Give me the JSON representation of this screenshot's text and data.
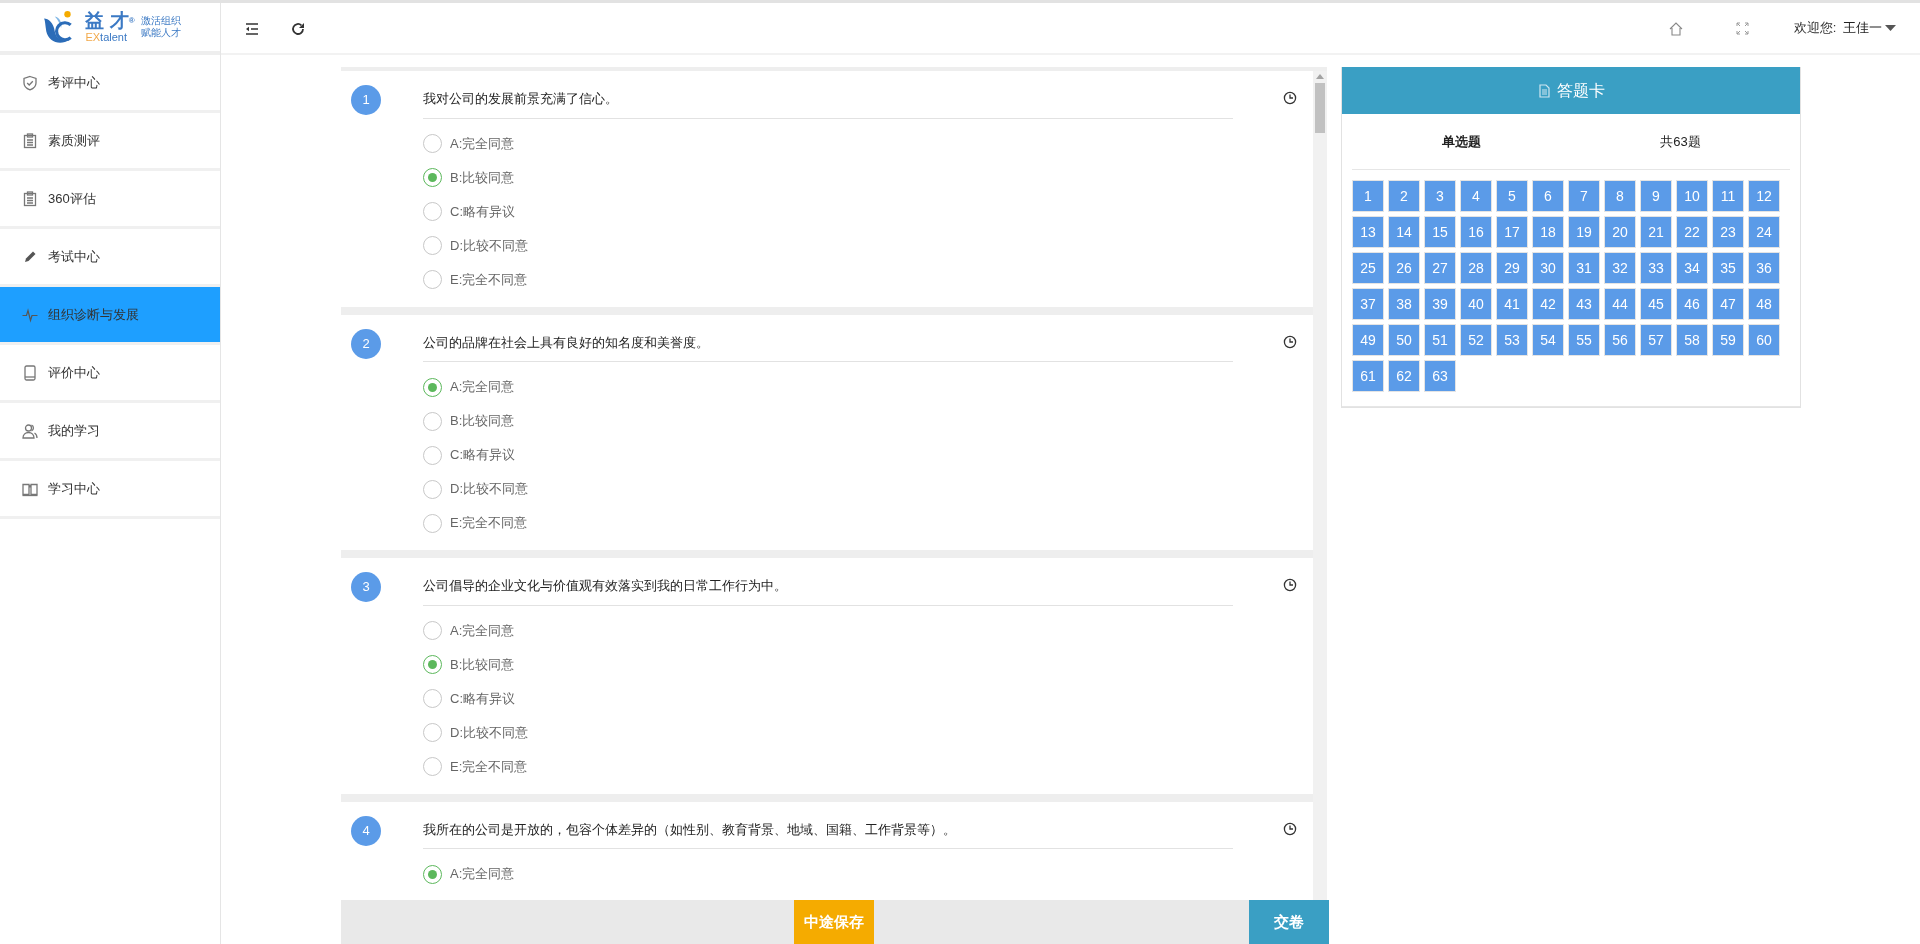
{
  "logo": {
    "brand": "益 才",
    "reg": "®",
    "en_accent": "EX",
    "en_rest": "talent",
    "tagline_1": "激活组织",
    "tagline_2": "赋能人才"
  },
  "sidebar": {
    "items": [
      {
        "label": "考评中心",
        "selected": false
      },
      {
        "label": "素质测评",
        "selected": false
      },
      {
        "label": "360评估",
        "selected": false
      },
      {
        "label": "考试中心",
        "selected": false
      },
      {
        "label": "组织诊断与发展",
        "selected": true
      },
      {
        "label": "评价中心",
        "selected": false
      },
      {
        "label": "我的学习",
        "selected": false
      },
      {
        "label": "学习中心",
        "selected": false
      }
    ]
  },
  "header": {
    "welcome": "欢迎您:",
    "user": "王佳一"
  },
  "questions": [
    {
      "number": "1",
      "text": "我对公司的发展前景充满了信心。",
      "options": [
        {
          "label": "A:完全同意",
          "selected": false
        },
        {
          "label": "B:比较同意",
          "selected": true
        },
        {
          "label": "C:略有异议",
          "selected": false
        },
        {
          "label": "D:比较不同意",
          "selected": false
        },
        {
          "label": "E:完全不同意",
          "selected": false
        }
      ]
    },
    {
      "number": "2",
      "text": "公司的品牌在社会上具有良好的知名度和美誉度。",
      "options": [
        {
          "label": "A:完全同意",
          "selected": true
        },
        {
          "label": "B:比较同意",
          "selected": false
        },
        {
          "label": "C:略有异议",
          "selected": false
        },
        {
          "label": "D:比较不同意",
          "selected": false
        },
        {
          "label": "E:完全不同意",
          "selected": false
        }
      ]
    },
    {
      "number": "3",
      "text": "公司倡导的企业文化与价值观有效落实到我的日常工作行为中。",
      "options": [
        {
          "label": "A:完全同意",
          "selected": false
        },
        {
          "label": "B:比较同意",
          "selected": true
        },
        {
          "label": "C:略有异议",
          "selected": false
        },
        {
          "label": "D:比较不同意",
          "selected": false
        },
        {
          "label": "E:完全不同意",
          "selected": false
        }
      ]
    },
    {
      "number": "4",
      "text": "我所在的公司是开放的，包容个体差异的（如性别、教育背景、地域、国籍、工作背景等）。",
      "options": [
        {
          "label": "A:完全同意",
          "selected": true
        }
      ]
    }
  ],
  "footer": {
    "save": "中途保存",
    "submit": "交卷"
  },
  "answer_card": {
    "title": "答题卡",
    "type": "单选题",
    "total": "共63题",
    "numbers": [
      "1",
      "2",
      "3",
      "4",
      "5",
      "6",
      "7",
      "8",
      "9",
      "10",
      "11",
      "12",
      "13",
      "14",
      "15",
      "16",
      "17",
      "18",
      "19",
      "20",
      "21",
      "22",
      "23",
      "24",
      "25",
      "26",
      "27",
      "28",
      "29",
      "30",
      "31",
      "32",
      "33",
      "34",
      "35",
      "36",
      "37",
      "38",
      "39",
      "40",
      "41",
      "42",
      "43",
      "44",
      "45",
      "46",
      "47",
      "48",
      "49",
      "50",
      "51",
      "52",
      "53",
      "54",
      "55",
      "56",
      "57",
      "58",
      "59",
      "60",
      "61",
      "62",
      "63"
    ]
  }
}
